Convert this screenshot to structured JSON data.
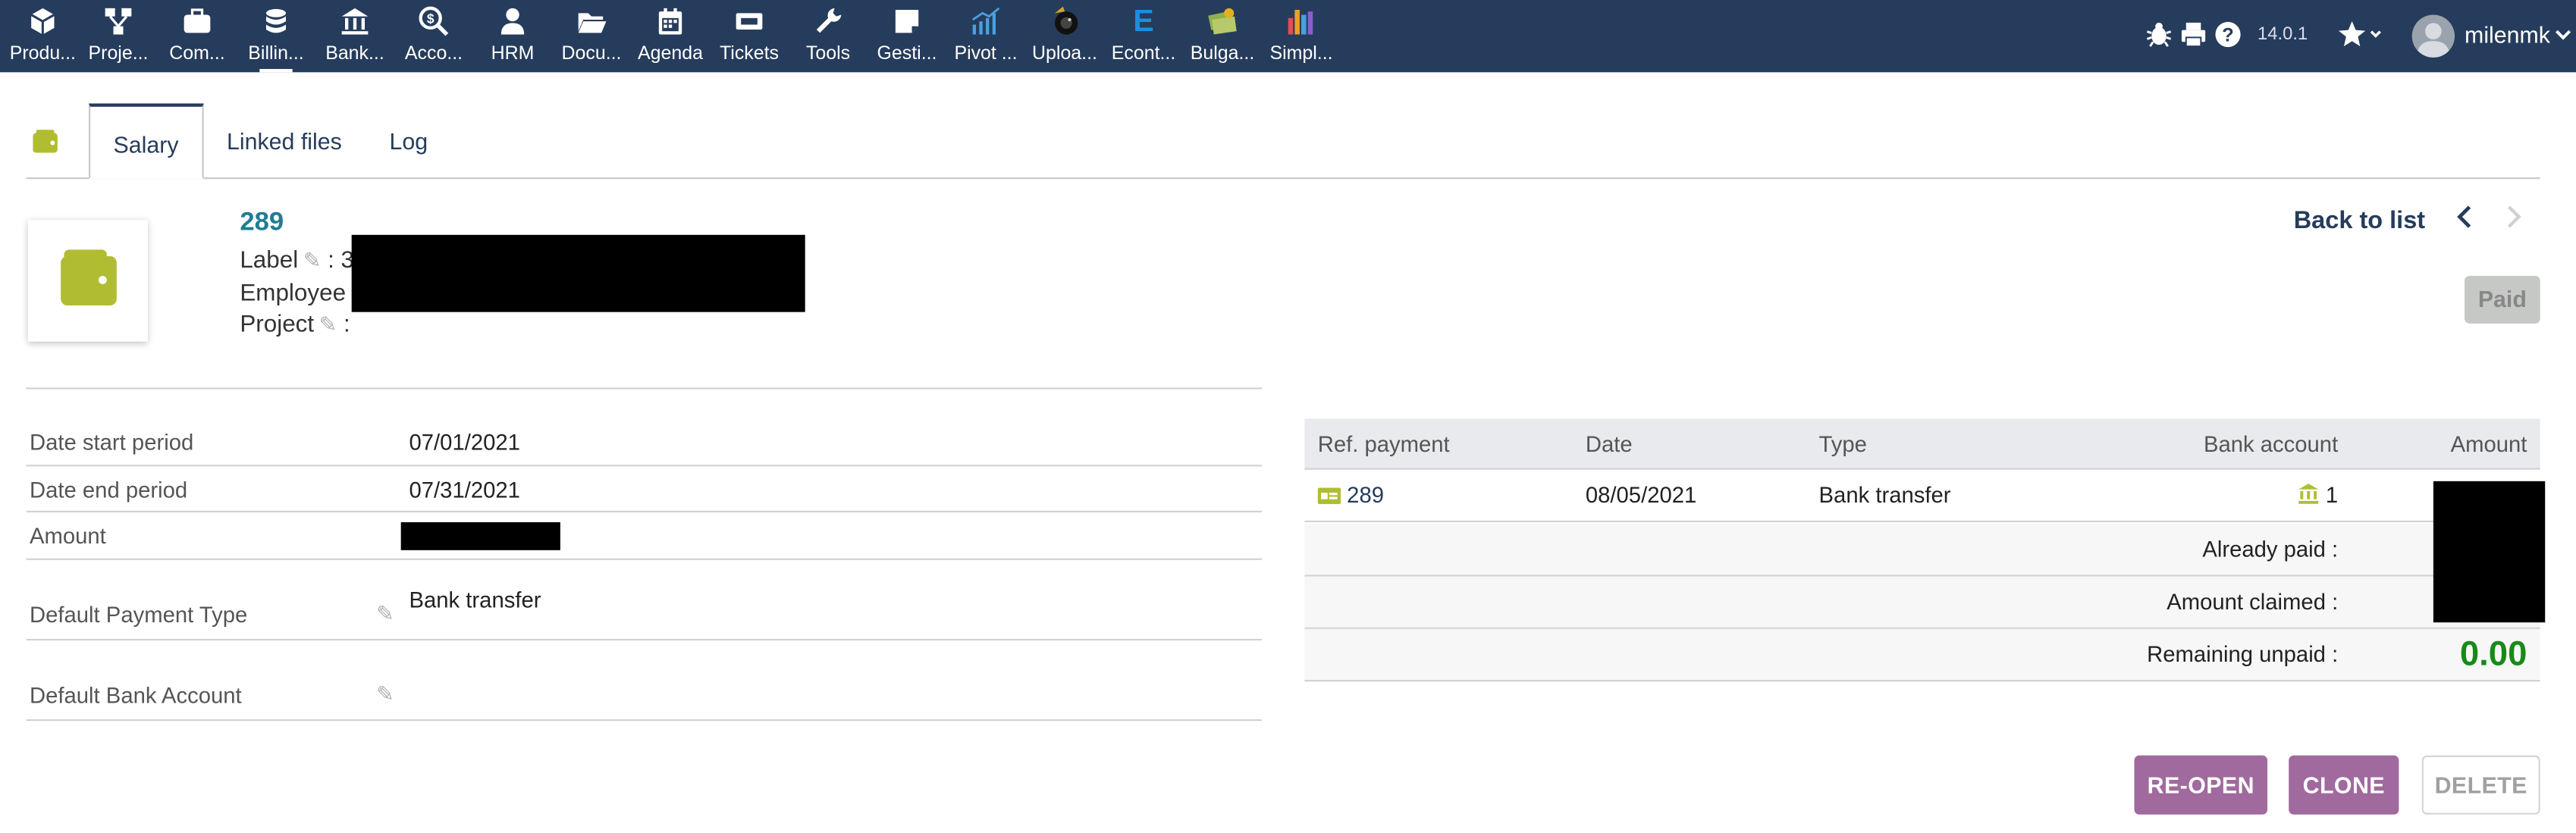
{
  "topbar": {
    "menu": [
      {
        "label": "Produ...",
        "icon": "cube-icon"
      },
      {
        "label": "Proje...",
        "icon": "project-tree-icon"
      },
      {
        "label": "Com...",
        "icon": "briefcase-icon"
      },
      {
        "label": "Billin...",
        "icon": "coins-icon",
        "active": true
      },
      {
        "label": "Bank...",
        "icon": "bank-icon"
      },
      {
        "label": "Acco...",
        "icon": "accounting-search-icon"
      },
      {
        "label": "HRM",
        "icon": "user-tie-icon"
      },
      {
        "label": "Docu...",
        "icon": "folder-open-icon"
      },
      {
        "label": "Agenda",
        "icon": "calendar-icon"
      },
      {
        "label": "Tickets",
        "icon": "ticket-icon"
      },
      {
        "label": "Tools",
        "icon": "wrench-icon"
      },
      {
        "label": "Gesti...",
        "icon": "sticky-note-icon"
      },
      {
        "label": "Pivot ...",
        "icon": "pivot-chart-icon"
      },
      {
        "label": "Uploa...",
        "icon": "upload-camera-icon"
      },
      {
        "label": "Econt...",
        "icon": "econt-e-icon"
      },
      {
        "label": "Bulga...",
        "icon": "bulgaria-money-icon"
      },
      {
        "label": "Simpl...",
        "icon": "simple-bars-icon"
      }
    ],
    "version": "14.0.1",
    "username": "milenmk"
  },
  "tabs": [
    {
      "label": "Salary",
      "active": true
    },
    {
      "label": "Linked files"
    },
    {
      "label": "Log"
    }
  ],
  "header": {
    "ref": "289",
    "label_caption": "Label",
    "label_value_visible": "3",
    "employee_caption": "Employee",
    "project_caption": "Project",
    "back_to_list": "Back to list",
    "prev_arrow": "‹",
    "next_arrow": "›",
    "status": "Paid"
  },
  "fields": [
    {
      "label": "Date start period",
      "value": "07/01/2021"
    },
    {
      "label": "Date end period",
      "value": "07/31/2021"
    },
    {
      "label": "Amount",
      "value": ""
    },
    {
      "label": "Default Payment Type",
      "value": "Bank transfer"
    },
    {
      "label": "Default Bank Account",
      "value": ""
    }
  ],
  "payments": {
    "headers": {
      "ref": "Ref. payment",
      "date": "Date",
      "type": "Type",
      "bank": "Bank account",
      "amount": "Amount"
    },
    "rows": [
      {
        "ref": "289",
        "date": "08/05/2021",
        "type": "Bank transfer",
        "bank": "1"
      }
    ],
    "already_paid_label": "Already paid :",
    "amount_claimed_label": "Amount claimed :",
    "remaining_label": "Remaining unpaid :",
    "remaining_value": "0.00"
  },
  "actions": {
    "reopen": "RE-OPEN",
    "clone": "CLONE",
    "delete": "DELETE"
  },
  "colors": {
    "topbar": "#263c5c",
    "accent": "#b1bd31",
    "button": "#a06a9e",
    "remaining": "#188a18"
  }
}
